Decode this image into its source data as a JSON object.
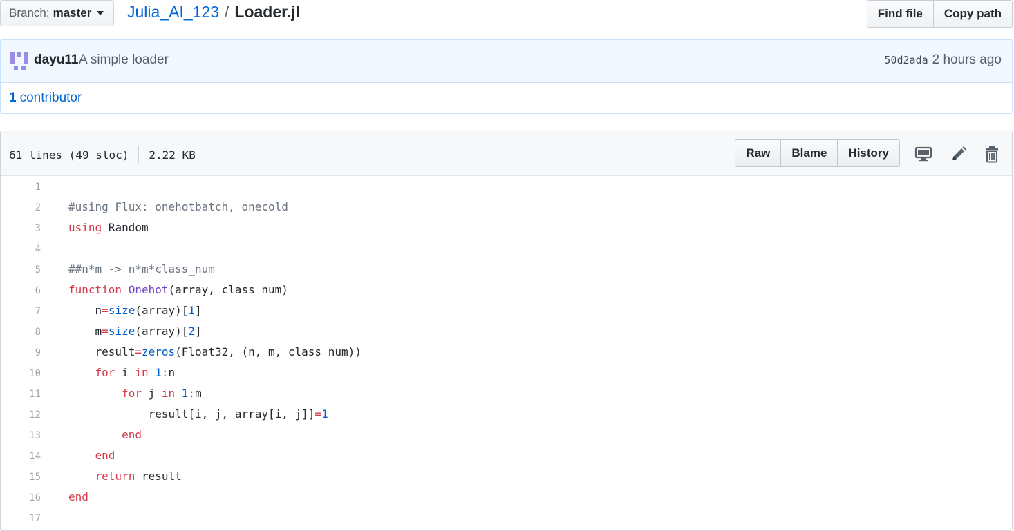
{
  "file_nav": {
    "branch_prefix": "Branch:",
    "branch_name": "master",
    "repo": "Julia_AI_123",
    "separator": "/",
    "file": "Loader.jl",
    "find_file": "Find file",
    "copy_path": "Copy path"
  },
  "commit": {
    "author": "dayu11",
    "message": "A simple loader",
    "sha": "50d2ada",
    "time": "2 hours ago"
  },
  "contributors": {
    "count": "1",
    "label": "contributor"
  },
  "file_header": {
    "lines_info": "61 lines (49 sloc)",
    "size": "2.22 KB",
    "raw": "Raw",
    "blame": "Blame",
    "history": "History",
    "icons": [
      "desktop-icon",
      "pencil-icon",
      "trash-icon"
    ]
  },
  "code": {
    "lines": [
      {
        "num": "1",
        "tokens": []
      },
      {
        "num": "2",
        "tokens": [
          {
            "t": "#using Flux: onehotbatch, onecold",
            "c": "comment"
          }
        ]
      },
      {
        "num": "3",
        "tokens": [
          {
            "t": "using",
            "c": "kw"
          },
          {
            "t": " Random",
            "c": ""
          }
        ]
      },
      {
        "num": "4",
        "tokens": []
      },
      {
        "num": "5",
        "tokens": [
          {
            "t": "##n*m -> n*m*class_num",
            "c": "comment"
          }
        ]
      },
      {
        "num": "6",
        "tokens": [
          {
            "t": "function",
            "c": "kw"
          },
          {
            "t": " ",
            "c": ""
          },
          {
            "t": "Onehot",
            "c": "fn"
          },
          {
            "t": "(array, class_num)",
            "c": ""
          }
        ]
      },
      {
        "num": "7",
        "tokens": [
          {
            "t": "    n",
            "c": ""
          },
          {
            "t": "=",
            "c": "op"
          },
          {
            "t": "size",
            "c": "builtin"
          },
          {
            "t": "(array)[",
            "c": ""
          },
          {
            "t": "1",
            "c": "num"
          },
          {
            "t": "]",
            "c": ""
          }
        ]
      },
      {
        "num": "8",
        "tokens": [
          {
            "t": "    m",
            "c": ""
          },
          {
            "t": "=",
            "c": "op"
          },
          {
            "t": "size",
            "c": "builtin"
          },
          {
            "t": "(array)[",
            "c": ""
          },
          {
            "t": "2",
            "c": "num"
          },
          {
            "t": "]",
            "c": ""
          }
        ]
      },
      {
        "num": "9",
        "tokens": [
          {
            "t": "    result",
            "c": ""
          },
          {
            "t": "=",
            "c": "op"
          },
          {
            "t": "zeros",
            "c": "builtin"
          },
          {
            "t": "(Float32, (n, m, class_num))",
            "c": ""
          }
        ]
      },
      {
        "num": "10",
        "tokens": [
          {
            "t": "    ",
            "c": ""
          },
          {
            "t": "for",
            "c": "kw"
          },
          {
            "t": " i ",
            "c": ""
          },
          {
            "t": "in",
            "c": "kw"
          },
          {
            "t": " ",
            "c": ""
          },
          {
            "t": "1",
            "c": "num"
          },
          {
            "t": ":",
            "c": "op"
          },
          {
            "t": "n",
            "c": ""
          }
        ]
      },
      {
        "num": "11",
        "tokens": [
          {
            "t": "        ",
            "c": ""
          },
          {
            "t": "for",
            "c": "kw"
          },
          {
            "t": " j ",
            "c": ""
          },
          {
            "t": "in",
            "c": "kw"
          },
          {
            "t": " ",
            "c": ""
          },
          {
            "t": "1",
            "c": "num"
          },
          {
            "t": ":",
            "c": "op"
          },
          {
            "t": "m",
            "c": ""
          }
        ]
      },
      {
        "num": "12",
        "tokens": [
          {
            "t": "            result[i, j, array[i, j]]",
            "c": ""
          },
          {
            "t": "=",
            "c": "op"
          },
          {
            "t": "1",
            "c": "num"
          }
        ]
      },
      {
        "num": "13",
        "tokens": [
          {
            "t": "        ",
            "c": ""
          },
          {
            "t": "end",
            "c": "kw"
          }
        ]
      },
      {
        "num": "14",
        "tokens": [
          {
            "t": "    ",
            "c": ""
          },
          {
            "t": "end",
            "c": "kw"
          }
        ]
      },
      {
        "num": "15",
        "tokens": [
          {
            "t": "    ",
            "c": ""
          },
          {
            "t": "return",
            "c": "kw"
          },
          {
            "t": " result",
            "c": ""
          }
        ]
      },
      {
        "num": "16",
        "tokens": [
          {
            "t": "end",
            "c": "kw"
          }
        ]
      },
      {
        "num": "17",
        "tokens": []
      }
    ]
  },
  "colors": {
    "link": "#0366d6",
    "keyword": "#d73a49",
    "function": "#6f42c1",
    "builtin": "#005cc5",
    "comment": "#6a737d",
    "commit_bg": "#f1f8ff"
  }
}
